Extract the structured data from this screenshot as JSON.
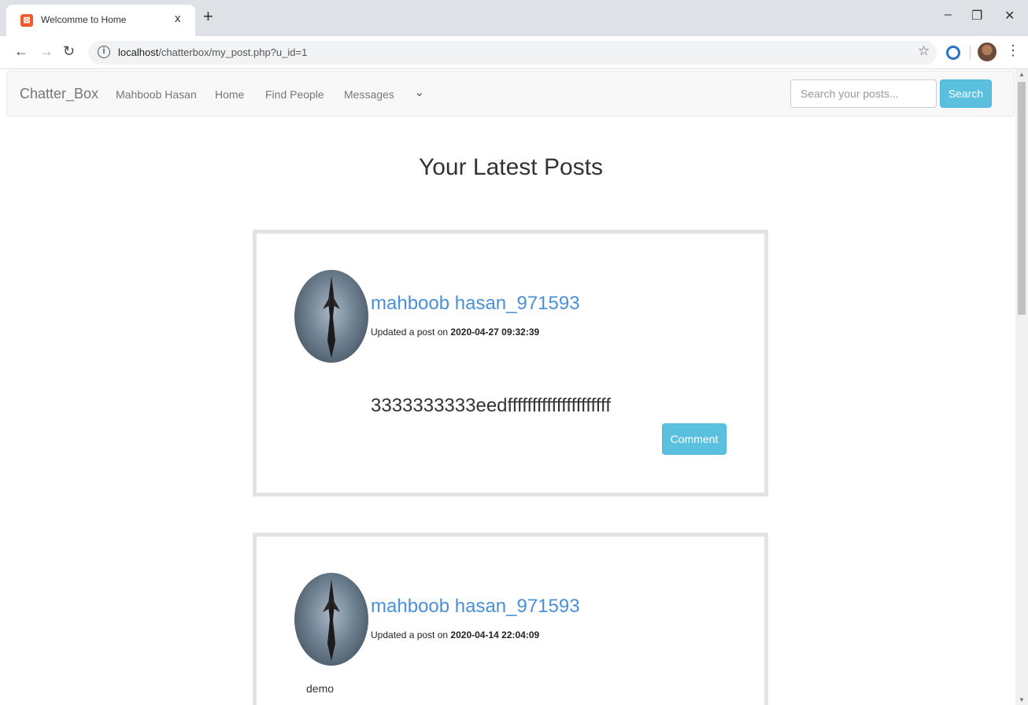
{
  "browser": {
    "tab_title": "Welcomme to Home",
    "tab_close": "x",
    "new_tab": "+",
    "url_host": "localhost",
    "url_path": "/chatterbox/my_post.php?u_id=1",
    "window_controls": {
      "minimize": "–",
      "restore": "❐",
      "close": "✕"
    }
  },
  "navbar": {
    "brand": "Chatter_Box",
    "links": [
      "Mahboob Hasan",
      "Home",
      "Find People",
      "Messages"
    ],
    "search_placeholder": "Search your posts...",
    "search_button": "Search"
  },
  "page": {
    "heading": "Your Latest Posts"
  },
  "posts": [
    {
      "author": "mahboob hasan_971593",
      "meta_prefix": "Updated a post on ",
      "timestamp": "2020-04-27 09:32:39",
      "body": "3333333333eedfffffffffffffffffffff",
      "comment_button": "Comment"
    },
    {
      "author": "mahboob hasan_971593",
      "meta_prefix": "Updated a post on ",
      "timestamp": "2020-04-14 22:04:09",
      "body": "demo"
    }
  ],
  "colors": {
    "accent": "#5bc0de",
    "author_link": "#4a90d9",
    "navbar_bg": "#f8f8f8",
    "post_border": "#e3e3e3"
  }
}
